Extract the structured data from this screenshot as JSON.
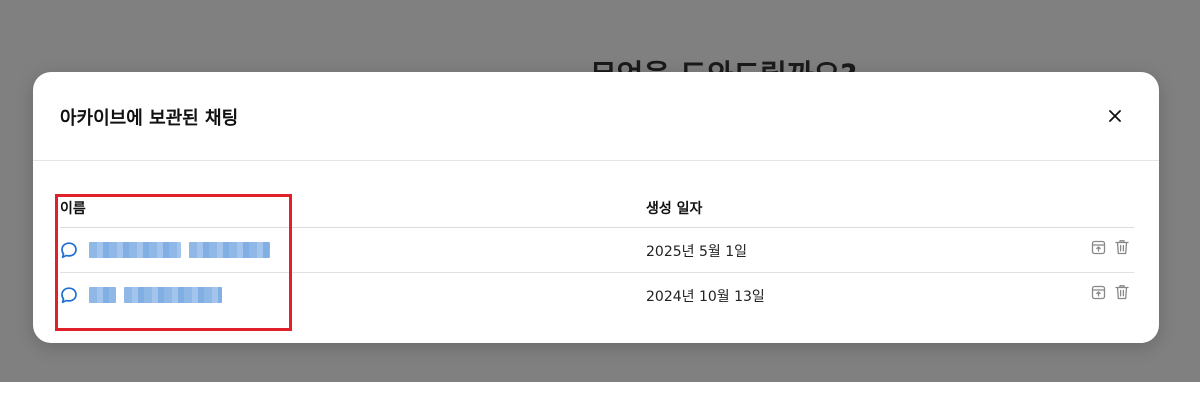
{
  "background": {
    "heading": "무엇을 도와드릴까요?"
  },
  "modal": {
    "title": "아카이브에 보관된 채팅",
    "close_icon": "close-icon",
    "columns": {
      "name": "이름",
      "created_date": "생성 일자"
    },
    "rows": [
      {
        "name": "",
        "created_date": "2025년 5월 1일",
        "icon": "chat-bubble-icon",
        "actions": [
          "unarchive-icon",
          "trash-icon"
        ]
      },
      {
        "name": "",
        "created_date": "2024년 10월 13일",
        "icon": "chat-bubble-icon",
        "actions": [
          "unarchive-icon",
          "trash-icon"
        ]
      }
    ]
  },
  "colors": {
    "overlay": "#808080",
    "chat_icon": "#1f6fd1",
    "highlight": "#e0202a"
  }
}
